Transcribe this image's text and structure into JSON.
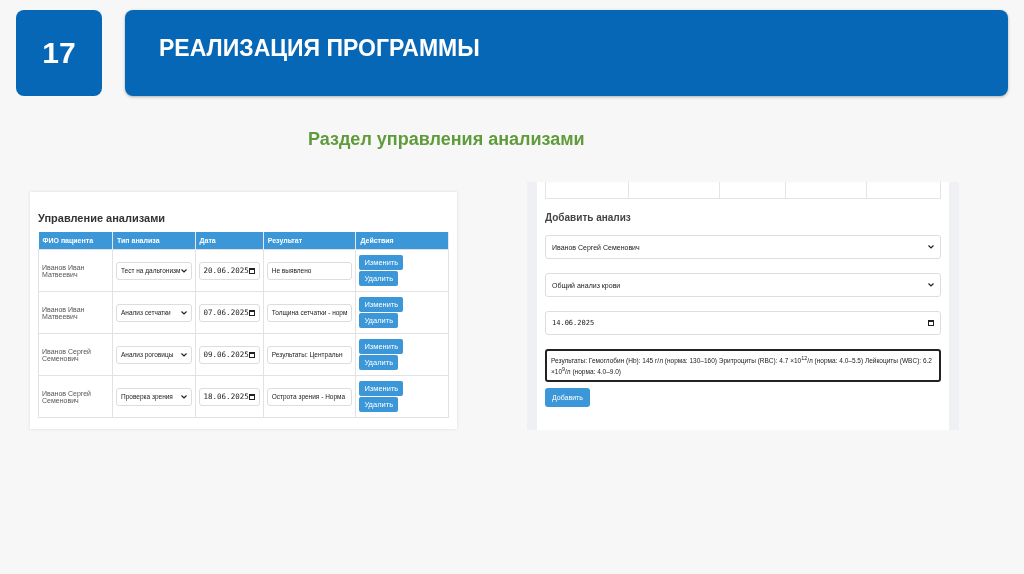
{
  "slide": {
    "number": "17",
    "title": "РЕАЛИЗАЦИЯ ПРОГРАММЫ",
    "subtitle": "Раздел управления анализами"
  },
  "table_panel": {
    "heading": "Управление анализами",
    "columns": [
      "ФИО пациента",
      "Тип анализа",
      "Дата",
      "Результат",
      "Действия"
    ],
    "rows": [
      {
        "patient": "Иванов Иван Матвеевич",
        "type": "Тест на дальтонизм",
        "date": "20.06.2025",
        "result": "Не выявлено",
        "edit": "Изменить",
        "delete": "Удалить"
      },
      {
        "patient": "Иванов Иван Матвеевич",
        "type": "Анализ сетчатки",
        "date": "07.06.2025",
        "result": "Толщина сетчатки - норм",
        "edit": "Изменить",
        "delete": "Удалить"
      },
      {
        "patient": "Иванов Сергей Семенович",
        "type": "Анализ роговицы",
        "date": "09.06.2025",
        "result": "Результаты:  Центральн",
        "edit": "Изменить",
        "delete": "Удалить"
      },
      {
        "patient": "Иванов Сергей Семенович",
        "type": "Проверка зрения",
        "date": "18.06.2025",
        "result": "Острота зрения - Норма",
        "edit": "Изменить",
        "delete": "Удалить"
      }
    ]
  },
  "form_panel": {
    "heading": "Добавить анализ",
    "patient": "Иванов Сергей Семенович",
    "type": "Общий анализ крови",
    "date": "14.06.2025",
    "result": "Результаты:  Гемоглобин (Hb): 145 г/л (норма: 130–160)  Эритроциты (RBC): 4.7 ×10$^{12}$/л (норма: 4.0–5.5)  Лейкоциты (WBC): 6.2 ×10$^{9}$/л (норма: 4.0–9.0)",
    "submit": "Добавить"
  }
}
